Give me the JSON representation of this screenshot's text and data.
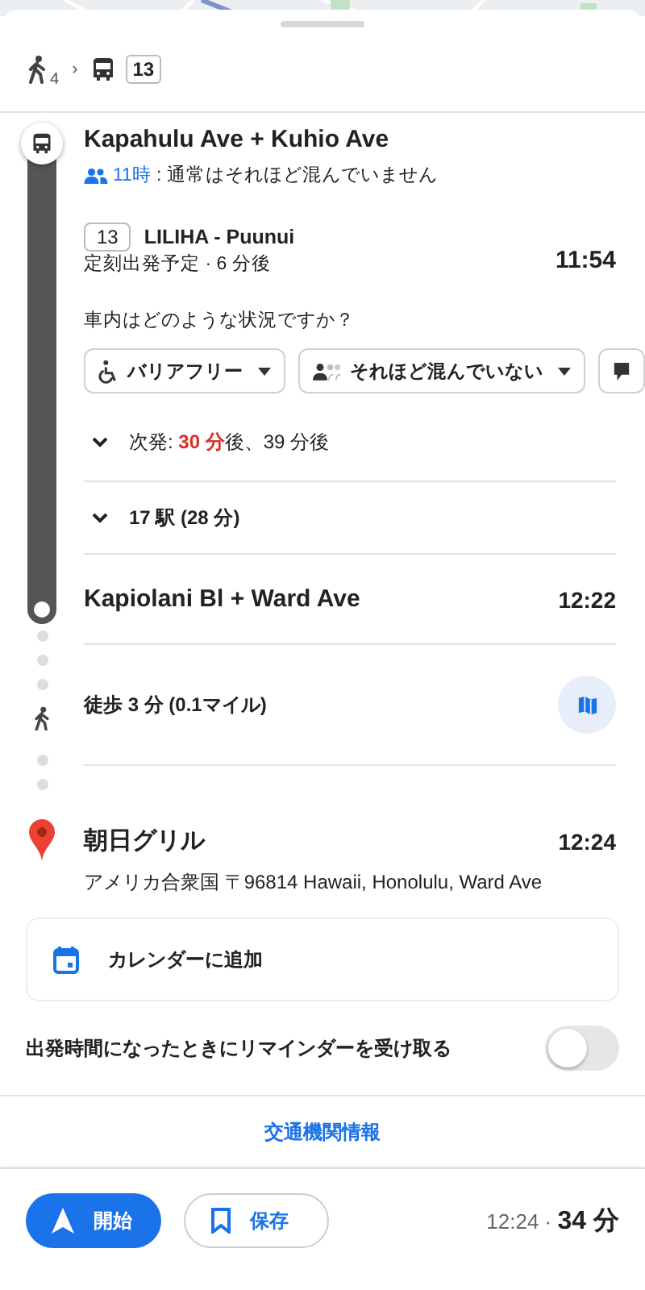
{
  "header": {
    "walk_minutes": "4",
    "separator": "›",
    "route_badge": "13"
  },
  "departure_stop": {
    "name": "Kapahulu Ave + Kuhio Ave",
    "crowd_time": "11時",
    "crowd_text": ": 通常はそれほど混んでいません"
  },
  "route": {
    "badge": "13",
    "headsign": "LILIHA - Puunui",
    "time": "11:54",
    "status": "定刻出発予定 · 6 分後"
  },
  "question": "車内はどのような状況ですか？",
  "chips": [
    {
      "kind": "accessible",
      "label": "バリアフリー"
    },
    {
      "kind": "crowd",
      "label": "それほど混んでいない"
    },
    {
      "kind": "other"
    }
  ],
  "next_departures": {
    "prefix": "次発: ",
    "highlight": "30 分",
    "suffix": "後、39 分後",
    "expanded": false
  },
  "stops_summary": {
    "label": "17 駅 (28 分)",
    "expanded": false
  },
  "arrival_stop": {
    "name": "Kapiolani Bl + Ward Ave",
    "time": "12:22"
  },
  "walk": {
    "label": "徒歩 3 分 (0.1マイル)"
  },
  "destination": {
    "name": "朝日グリル",
    "time": "12:24",
    "address": "アメリカ合衆国 〒96814 Hawaii, Honolulu, Ward Ave"
  },
  "calendar": {
    "label": "カレンダーに追加"
  },
  "reminder": {
    "label": "出発時間になったときにリマインダーを受け取る",
    "on": false
  },
  "transit_link": "交通機関情報",
  "bottom": {
    "start": "開始",
    "save": "保存",
    "arrival": "12:24",
    "separator": " · ",
    "duration": "34 分"
  }
}
